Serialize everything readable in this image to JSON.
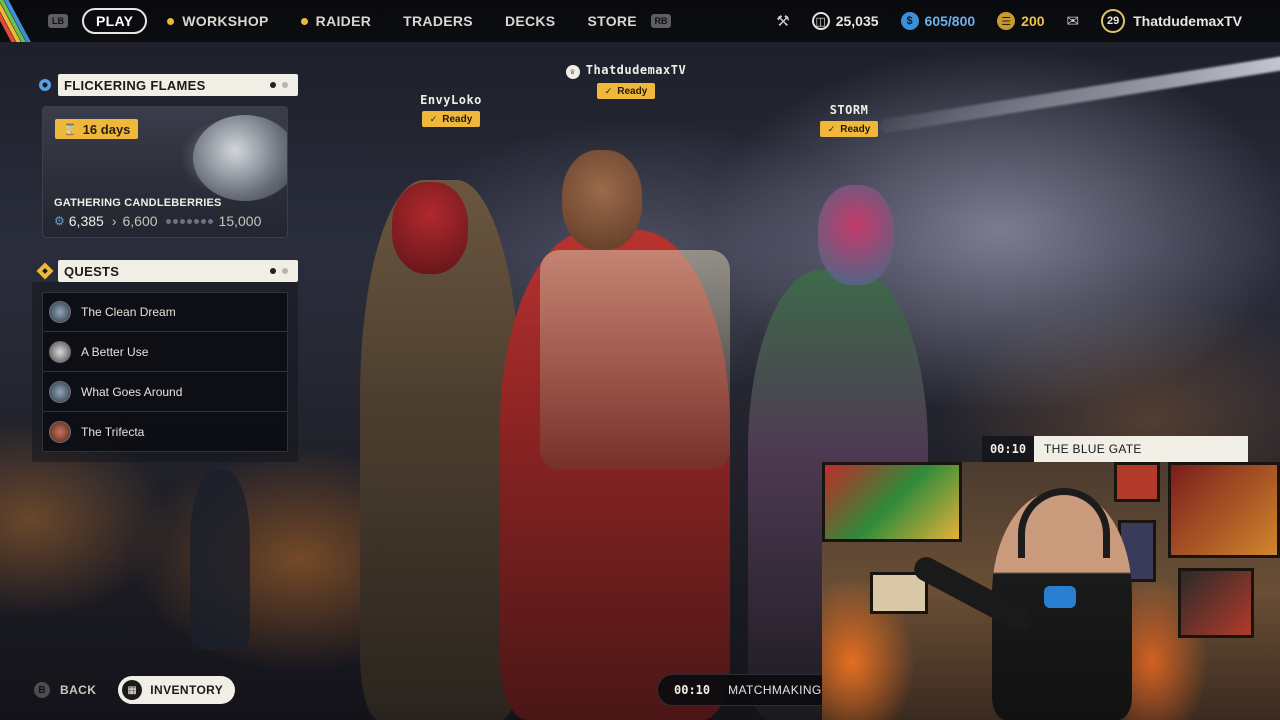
{
  "topbar": {
    "lb_label": "LB",
    "rb_label": "RB",
    "nav": [
      {
        "label": "PLAY",
        "active": true
      },
      {
        "label": "WORKSHOP",
        "dot": true
      },
      {
        "label": "RAIDER",
        "dot": true
      },
      {
        "label": "TRADERS"
      },
      {
        "label": "DECKS"
      },
      {
        "label": "STORE"
      }
    ],
    "currency_a": "25,035",
    "currency_b": "605/800",
    "currency_c": "200",
    "level": "29",
    "username": "ThatdudemaxTV"
  },
  "event": {
    "title": "FLICKERING FLAMES",
    "days": "16 days",
    "name": "GATHERING CANDLEBERRIES",
    "current": "6,385",
    "next": "6,600",
    "max": "15,000"
  },
  "quests": {
    "title": "QUESTS",
    "items": [
      {
        "label": "The Clean Dream"
      },
      {
        "label": "A Better Use"
      },
      {
        "label": "What Goes Around"
      },
      {
        "label": "The Trifecta"
      }
    ]
  },
  "players": [
    {
      "name": "EnvyLoko",
      "status": "Ready"
    },
    {
      "name": "ThatdudemaxTV",
      "status": "Ready",
      "leader": true
    },
    {
      "name": "STORM",
      "status": "Ready"
    }
  ],
  "bottom": {
    "back_key": "B",
    "back_label": "BACK",
    "inventory_label": "INVENTORY",
    "matchmaking_time": "00:10",
    "matchmaking_label": "MATCHMAKING"
  },
  "webcam": {
    "time": "00:10",
    "title": "THE BLUE GATE"
  },
  "colors": {
    "accent": "#f0b83a",
    "panel_header": "#f1eee6",
    "currency_blue": "#3d8fd6"
  }
}
